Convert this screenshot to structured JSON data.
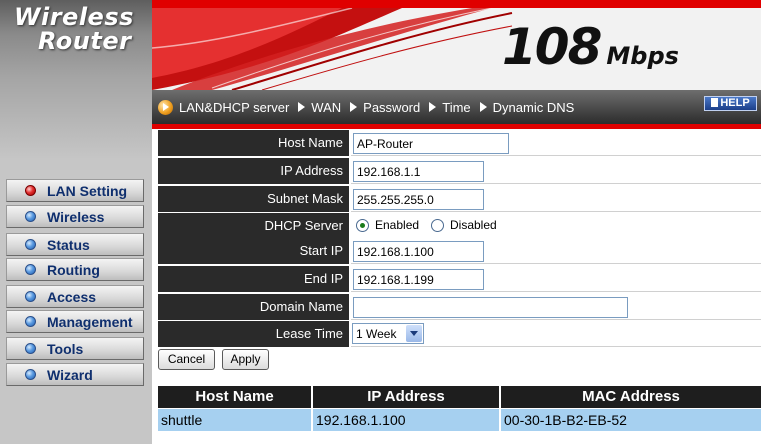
{
  "brand": {
    "line1": "Wireless",
    "line2": "Router"
  },
  "header": {
    "speed_number": "108",
    "speed_unit": "Mbps"
  },
  "top_nav": {
    "tabs": [
      "LAN&DHCP server",
      "WAN",
      "Password",
      "Time",
      "Dynamic DNS"
    ],
    "help_label": "HELP"
  },
  "sidebar": {
    "items": [
      {
        "label": "LAN Setting",
        "active": true
      },
      {
        "label": "Wireless",
        "active": false
      },
      {
        "label": "Status",
        "active": false
      },
      {
        "label": "Routing",
        "active": false
      },
      {
        "label": "Access",
        "active": false
      },
      {
        "label": "Management",
        "active": false
      },
      {
        "label": "Tools",
        "active": false
      },
      {
        "label": "Wizard",
        "active": false
      }
    ]
  },
  "form": {
    "host_name": {
      "label": "Host Name",
      "value": "AP-Router"
    },
    "ip_address": {
      "label": "IP Address",
      "value": "192.168.1.1"
    },
    "subnet_mask": {
      "label": "Subnet Mask",
      "value": "255.255.255.0"
    },
    "dhcp_server": {
      "label": "DHCP Server",
      "enabled_label": "Enabled",
      "disabled_label": "Disabled",
      "selected": "Enabled"
    },
    "start_ip": {
      "label": "Start IP",
      "value": "192.168.1.100"
    },
    "end_ip": {
      "label": "End IP",
      "value": "192.168.1.199"
    },
    "domain_name": {
      "label": "Domain Name",
      "value": ""
    },
    "lease_time": {
      "label": "Lease Time",
      "value": "1 Week"
    },
    "cancel_label": "Cancel",
    "apply_label": "Apply"
  },
  "dhcp_table": {
    "columns": [
      "Host Name",
      "IP Address",
      "MAC Address"
    ],
    "rows": [
      [
        "shuttle",
        "192.168.1.100",
        "00-30-1B-B2-EB-52"
      ]
    ]
  },
  "colors": {
    "accent_red": "#e00000",
    "nav_dark": "#2c2c2c",
    "label_bg": "#2a2a2a",
    "row_highlight": "#a6d0f0",
    "sidebar_text": "#0f2f6e"
  }
}
